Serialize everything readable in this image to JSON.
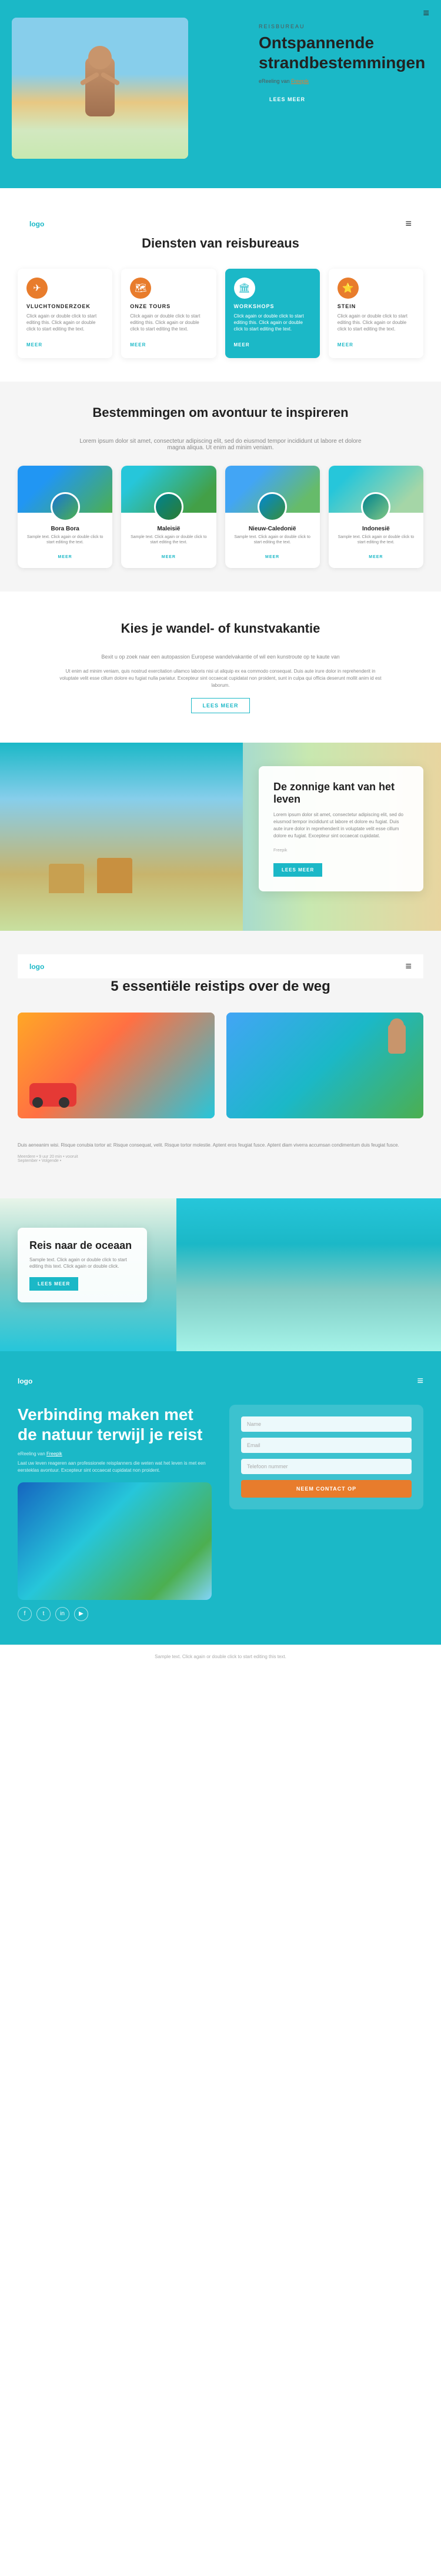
{
  "hero": {
    "nav": {
      "logo": "logo",
      "hamburger": "≡"
    },
    "label": "REISBUREAU",
    "title": "Ontspannende strandbestemmingen",
    "subtitle_text": "eReeling van",
    "subtitle_link": "Freepik",
    "cta": "LEES MEER"
  },
  "services": {
    "section_title": "Diensten van reisbureaus",
    "cards": [
      {
        "icon": "✈",
        "title": "VLUCHTONDERZOEK",
        "text": "Click again or double click to start editing this. Click again or double click to start editing the text.",
        "meer": "MEER"
      },
      {
        "icon": "🗺",
        "title": "ONZE TOURS",
        "text": "Click again or double click to start editing this. Click again or double click to start editing the text.",
        "meer": "MEER",
        "highlight": false
      },
      {
        "icon": "🏛",
        "title": "WORKSHOPS",
        "text": "Click again or double click to start editing this. Click again or double click to start editing the text.",
        "meer": "MEER",
        "highlight": true
      },
      {
        "icon": "⭐",
        "title": "STEIN",
        "text": "Click again or double click to start editing this. Click again or double click to start editing the text.",
        "meer": "MEER",
        "highlight": false
      }
    ]
  },
  "destinations": {
    "section_title": "Bestemmingen om avontuur te inspireren",
    "section_subtitle": "Lorem ipsum dolor sit amet, consectetur adipiscing elit, sed do eiusmod tempor incididunt ut labore et dolore magna aliqua. Ut enim ad minim veniam.",
    "items": [
      {
        "name": "Bora Bora",
        "text": "Sample text. Click again or double click to start editing the text.",
        "meer": "MEER"
      },
      {
        "name": "Maleisië",
        "text": "Sample text. Click again or double click to start editing the text.",
        "meer": "MEER"
      },
      {
        "name": "Nieuw-Caledonië",
        "text": "Sample text. Click again or double click to start editing the text.",
        "meer": "MEER"
      },
      {
        "name": "Indonesië",
        "text": "Sample text. Click again or double click to start editing the text.",
        "meer": "MEER"
      }
    ]
  },
  "wandel": {
    "section_title": "Kies je wandel- of kunstvakantie",
    "subtitle": "Bexit u op zoek naar een autopassion Europese wandelvakantie of wil een kunstroute op te kaute van",
    "body": "Ut enim ad minim veniam, quis nostrud exercitation ullamco laboris nisi ut aliquip ex ea commodo consequat. Duis aute irure dolor in reprehenderit in voluptate velit esse cillum dolore eu fugiat nulla pariatur. Excepteur sint occaecat cupidatat non proident, sunt in culpa qui officia deserunt mollit anim id est laborum.",
    "cta": "LEES MEER"
  },
  "zonnig": {
    "section_title": "De zonnige kant van het leven",
    "text": "Lorem ipsum dolor sit amet, consectetur adipiscing elit, sed do eiusmod tempor incididunt ut labore et dolore eu fugiat. Duis aute irure dolor in reprehenderit in voluptate velit esse cillum dolore eu fugiat. Excepteur sint occaecat cupidatat.",
    "author": "Freepik",
    "cta": "LEES MEER"
  },
  "reistips": {
    "section_title": "5 essentiële reistips over de weg",
    "text": "Duis aeneanim wisi. Risque conubia tortor at: Risque consequat, velit. Risque tortor molestie. Aptent eros feugiat fusce. Aptent diam viverra accumsan condimentum duis feugiat fusce.",
    "meta": "Meerdere • 9 uur 20 min • vooruit",
    "date": "September • Volgende •"
  },
  "oceaan": {
    "section_title": "Reis naar de oceaan",
    "text": "Sample text. Click again or double click to start editing this text. Click again or double click.",
    "cta": "LEES MEER"
  },
  "footer_hero": {
    "nav": {
      "logo": "logo",
      "hamburger": "≡"
    },
    "title": "Verbinding maken met de natuur terwijl je reist",
    "subtitle_text": "eReeling van",
    "subtitle_link": "Freepik",
    "desc": "Laat uw leven reageren aan professionele reisplanners die weten wat het leven is met een eersteklas avontuur. Excepteur sint occaecat cupidatat non proident.",
    "social_icons": [
      "f",
      "t",
      "in",
      "yt"
    ],
    "form": {
      "name_placeholder": "Name",
      "email_placeholder": "Email",
      "phone_placeholder": "Telefoon nummer",
      "cta": "NEEM CONTACT OP"
    }
  },
  "footer_bottom": {
    "text": "Sample text. Click again or double click to start editing this text."
  }
}
